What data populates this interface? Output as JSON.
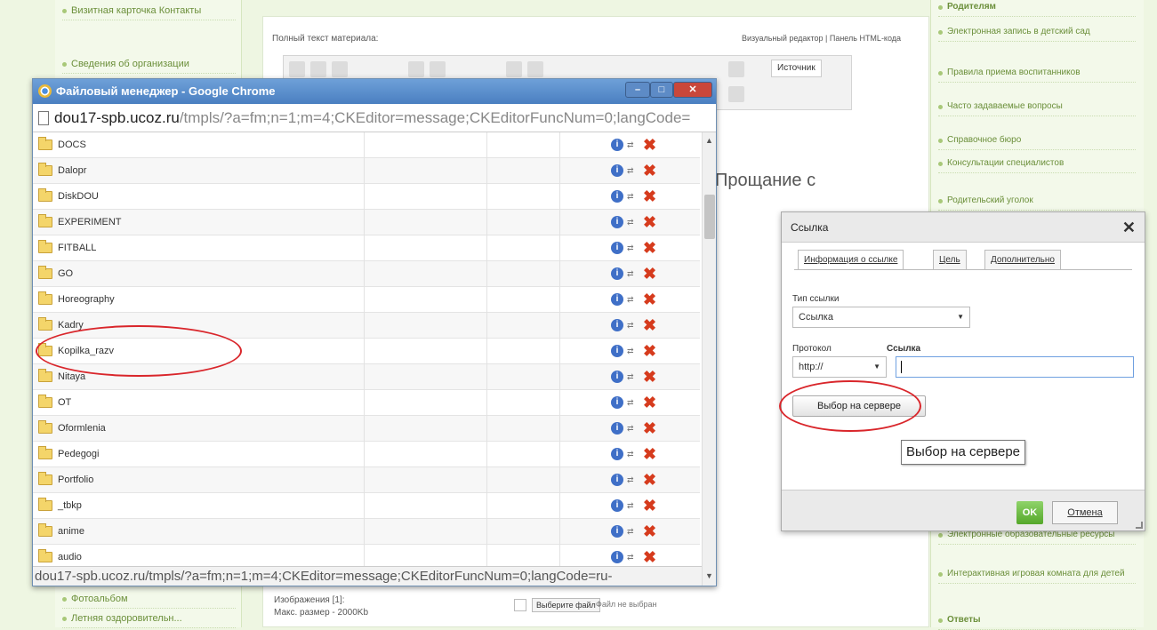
{
  "background": {
    "left_sidebar": [
      "Визитная карточка Контакты",
      "Сведения об организации",
      "Фотоальбом",
      "Летняя оздоровительн..."
    ],
    "right_sidebar": [
      "Родителям",
      "Электронная запись в детский сад",
      "Правила приема воспитанников",
      "Часто задаваемые вопросы",
      "Справочное бюро",
      "Консультации специалистов",
      "Родительский уголок",
      "Электронные образовательные ресурсы",
      "Интерактивная игровая комната для детей",
      "Ответы"
    ],
    "editor_label": "Полный текст материала:",
    "editor_modes": "Визуальный редактор | Панель HTML-кода",
    "source_button": "Источник",
    "content_heading": "Прощание с",
    "attach_label": "Изображения [1]:",
    "attach_max": "Макс. размер - 2000Kb",
    "choose_file": "Выберите файл",
    "no_file": "Файл не выбран"
  },
  "file_manager": {
    "title": "Файловый менеджер - Google Chrome",
    "address_host": "dou17-spb.ucoz.ru",
    "address_path": "/tmpls/?a=fm;n=1;m=4;CKEditor=message;CKEditorFuncNum=0;langCode=",
    "status_url": "dou17-spb.ucoz.ru/tmpls/?a=fm;n=1;m=4;CKEditor=message;CKEditorFuncNum=0;langCode=ru-",
    "folders": [
      "DOCS",
      "Dalopr",
      "DiskDOU",
      "EXPERIMENT",
      "FITBALL",
      "GO",
      "Horeography",
      "Kadry",
      "Kopilka_razv",
      "Nitaya",
      "OT",
      "Oformlenia",
      "Pedegogi",
      "Portfolio",
      "_tbkp",
      "anime",
      "audio"
    ],
    "highlighted": "Kopilka_razv"
  },
  "link_dialog": {
    "title": "Ссылка",
    "tabs": [
      "Информация о ссылке",
      "Цель",
      "Дополнительно"
    ],
    "link_type_label": "Тип ссылки",
    "link_type_value": "Ссылка",
    "protocol_label": "Протокол",
    "protocol_value": "http://",
    "url_label": "Ссылка",
    "browse_server": "Выбор на сервере",
    "tooltip": "Выбор на сервере",
    "ok": "OK",
    "cancel": "Отмена"
  },
  "colors": {
    "accent": "#4a7fc1",
    "annotation": "#d9262b",
    "ok": "#55a82a"
  }
}
